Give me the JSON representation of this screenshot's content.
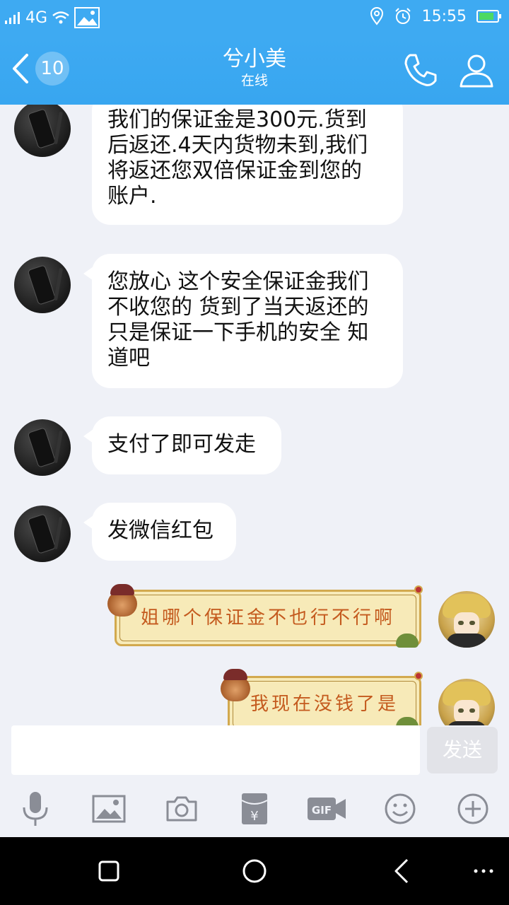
{
  "status_bar": {
    "network": "4G",
    "time": "15:55",
    "battery_level": 0.85,
    "icons": [
      "signal-icon",
      "wifi-icon",
      "image-icon",
      "location-icon",
      "alarm-icon",
      "battery-icon"
    ]
  },
  "header": {
    "back_badge": "10",
    "title": "兮小美",
    "subtitle": "在线",
    "icons": [
      "back-chevron-icon",
      "phone-icon",
      "profile-icon"
    ]
  },
  "messages": [
    {
      "sender": "other",
      "lines": [
        "我们的保证金是300元.货到",
        "后返还.4天内货物未到,我们",
        "将返还您双倍保证金到您的",
        "账户."
      ]
    },
    {
      "sender": "other",
      "lines": [
        "您放心 这个安全保证金我们",
        "不收您的 货到了当天返还的",
        "只是保证一下手机的安全 知",
        "道吧"
      ]
    },
    {
      "sender": "other",
      "lines": [
        "支付了即可发走"
      ]
    },
    {
      "sender": "other",
      "lines": [
        "发微信红包"
      ]
    },
    {
      "sender": "me",
      "lines": [
        "姐哪个保证金不也行不行啊"
      ]
    },
    {
      "sender": "me",
      "lines": [
        "我现在没钱了是"
      ]
    }
  ],
  "input": {
    "value": "",
    "send_label": "发送"
  },
  "toolbar_icons": [
    "microphone-icon",
    "image-icon",
    "camera-icon",
    "red-packet-icon",
    "gif-icon",
    "emoji-icon",
    "plus-icon"
  ],
  "colors": {
    "header_blue": "#3eaaf2",
    "chat_bg": "#eff1f7",
    "bubble_white": "#ffffff",
    "fancy_bubble_bg": "#f7eab8",
    "fancy_bubble_text": "#c45a1e"
  }
}
